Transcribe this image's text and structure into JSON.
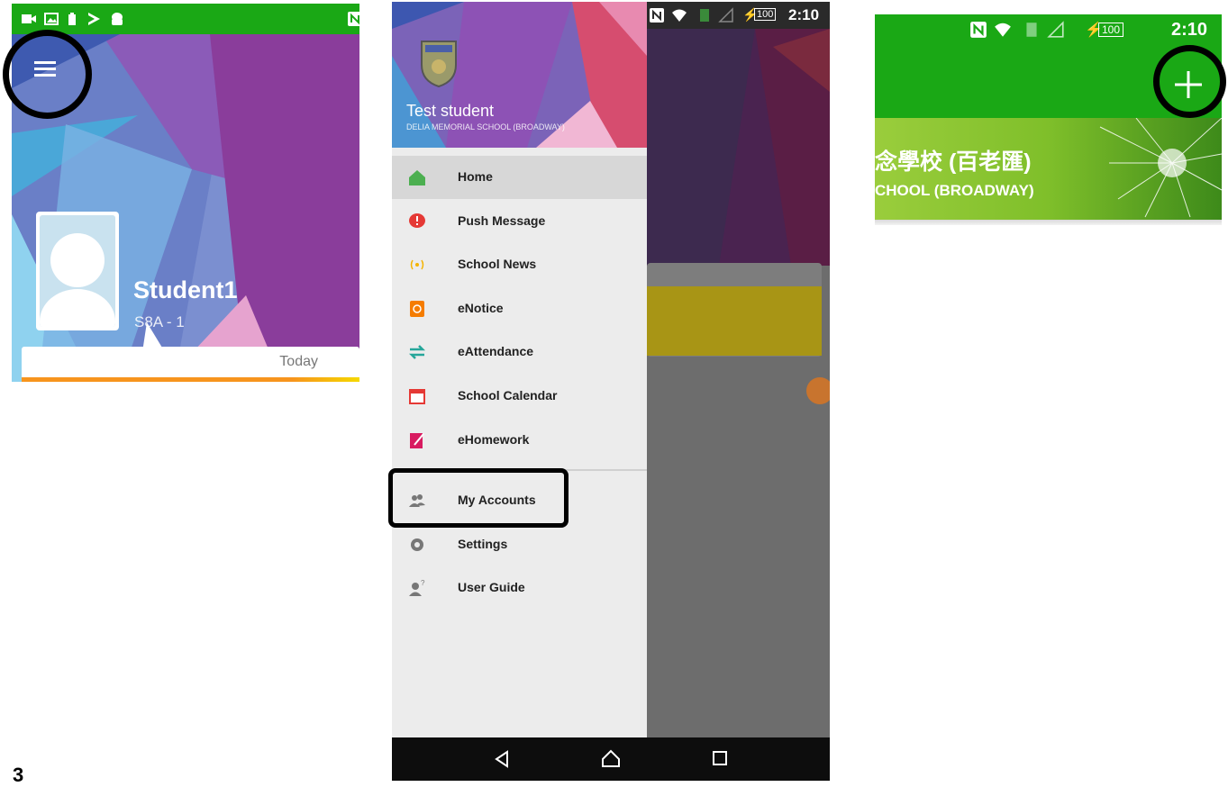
{
  "panel1": {
    "student_name": "Student1",
    "student_class": "S8A - 1",
    "tab_label": "Today",
    "icons": [
      "video-icon",
      "image-icon",
      "battery-icon",
      "play-store-icon",
      "android-icon",
      "nfc-icon",
      "menu-icon"
    ]
  },
  "panel2": {
    "status": {
      "time": "2:10",
      "battery": "100"
    },
    "user_name": "Test student",
    "school_name": "DELIA MEMORIAL SCHOOL (BROADWAY)",
    "menu": [
      {
        "label": "Home",
        "icon": "home-icon",
        "color": "#4caf50",
        "active": true
      },
      {
        "label": "Push Message",
        "icon": "push-message-icon",
        "color": "#e53935"
      },
      {
        "label": "School News",
        "icon": "broadcast-icon",
        "color": "#f5b400"
      },
      {
        "label": "eNotice",
        "icon": "notice-icon",
        "color": "#f57c00"
      },
      {
        "label": "eAttendance",
        "icon": "attendance-arrows-icon",
        "color": "#26a69a"
      },
      {
        "label": "School Calendar",
        "icon": "calendar-icon",
        "color": "#e53935"
      },
      {
        "label": "eHomework",
        "icon": "homework-icon",
        "color": "#d81b60"
      }
    ],
    "menu2": [
      {
        "label": "My Accounts",
        "icon": "accounts-icon",
        "color": "#777"
      },
      {
        "label": "Settings",
        "icon": "settings-gear-icon",
        "color": "#777"
      },
      {
        "label": "User Guide",
        "icon": "user-guide-icon",
        "color": "#777"
      }
    ],
    "nav": [
      "back-icon",
      "home-nav-icon",
      "recents-icon"
    ]
  },
  "panel3": {
    "status": {
      "time": "2:10",
      "battery": "100"
    },
    "school_zh": "念學校 (百老匯)",
    "school_en": "CHOOL (BROADWAY)"
  },
  "step_label": "3",
  "colors": {
    "green": "#1aa815",
    "highlight": "#000000"
  }
}
